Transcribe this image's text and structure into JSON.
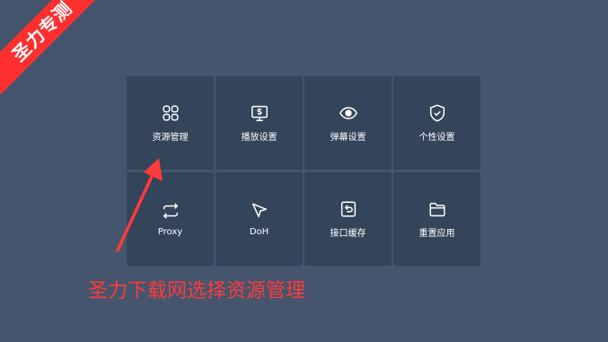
{
  "banner": {
    "text": "圣力专测"
  },
  "menu": {
    "items": [
      {
        "label": "资源管理",
        "icon": "grid-icon"
      },
      {
        "label": "播放设置",
        "icon": "monitor-icon"
      },
      {
        "label": "弹幕设置",
        "icon": "eye-icon"
      },
      {
        "label": "个性设置",
        "icon": "shield-check-icon"
      },
      {
        "label": "Proxy",
        "icon": "swap-arrows-icon"
      },
      {
        "label": "DoH",
        "icon": "cursor-icon"
      },
      {
        "label": "接口缓存",
        "icon": "undo-box-icon"
      },
      {
        "label": "重置应用",
        "icon": "folder-icon"
      }
    ]
  },
  "annotation": {
    "text": "圣力下载网选择资源管理",
    "color": "#ff3b3b"
  }
}
